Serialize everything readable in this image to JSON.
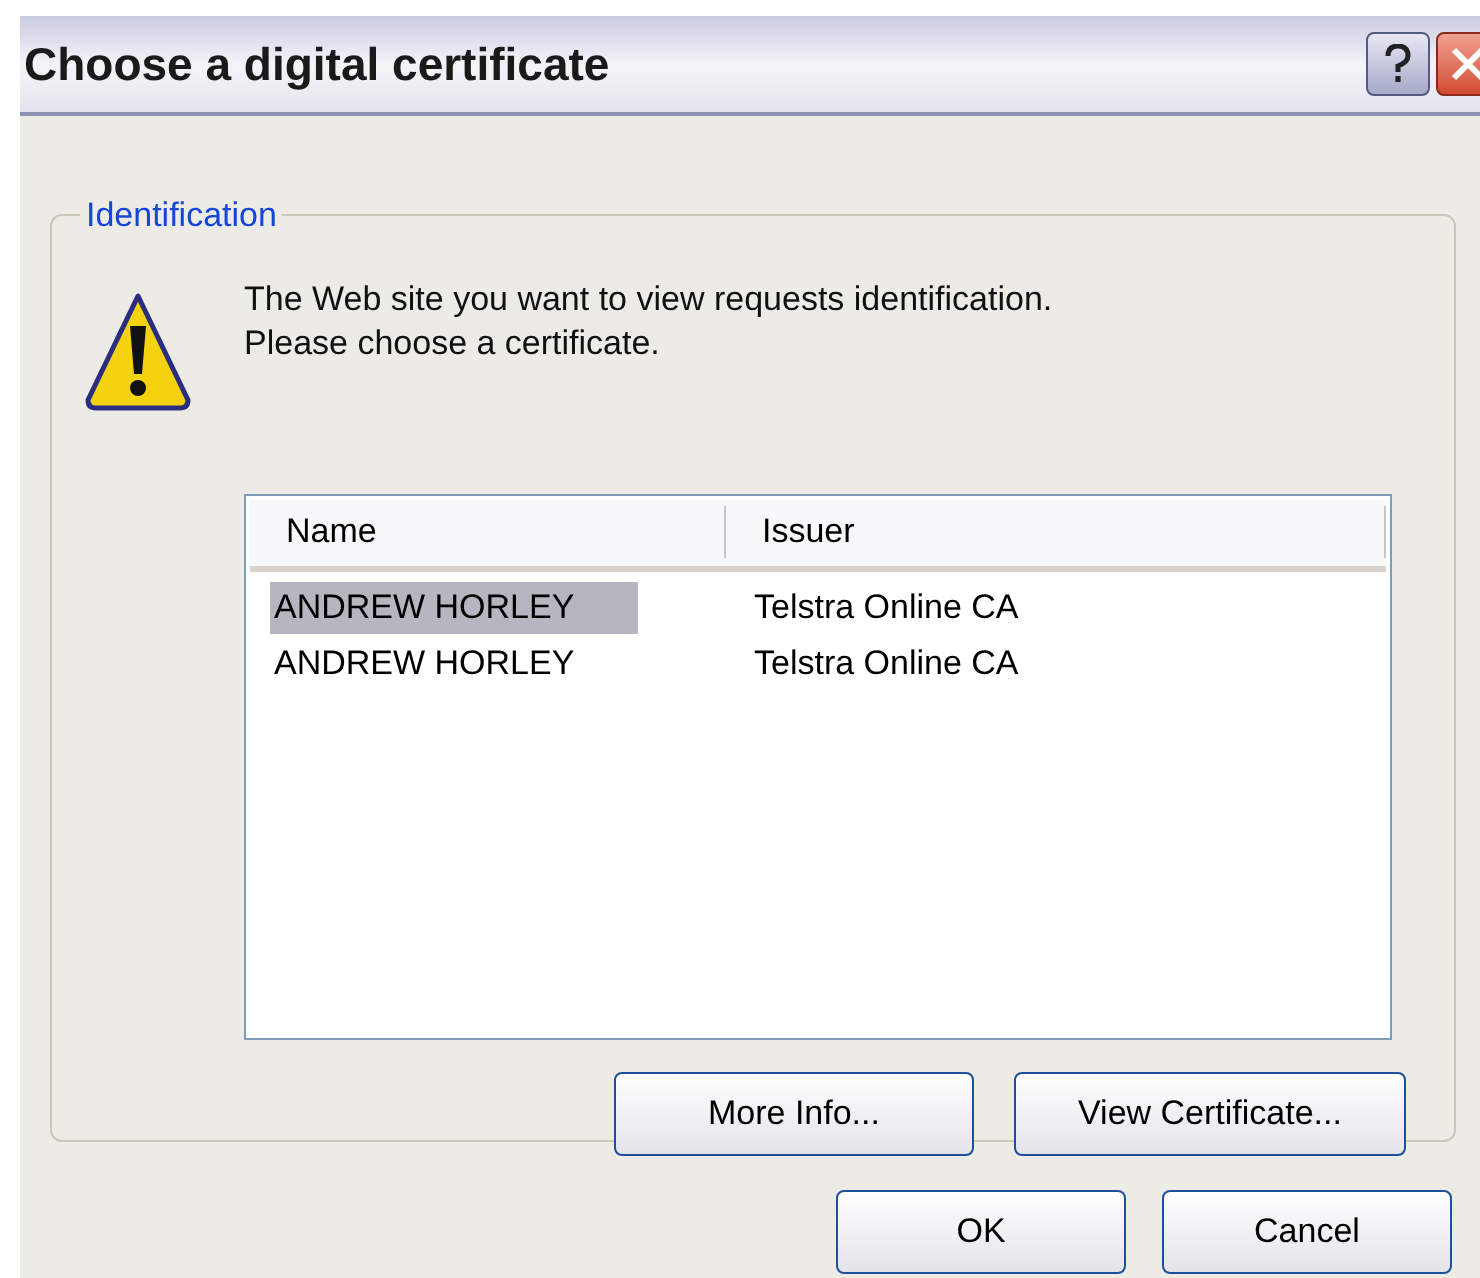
{
  "window": {
    "title": "Choose a digital certificate"
  },
  "group": {
    "legend": "Identification",
    "message": "The Web site you want to view requests identification. Please choose a certificate."
  },
  "table": {
    "columns": [
      "Name",
      "Issuer"
    ],
    "rows": [
      {
        "name": "ANDREW HORLEY",
        "issuer": "Telstra Online CA",
        "selected": true
      },
      {
        "name": "ANDREW HORLEY",
        "issuer": "Telstra Online CA",
        "selected": false
      }
    ]
  },
  "group_buttons": [
    "More Info...",
    "View Certificate..."
  ],
  "dialog_buttons": [
    "OK",
    "Cancel"
  ]
}
